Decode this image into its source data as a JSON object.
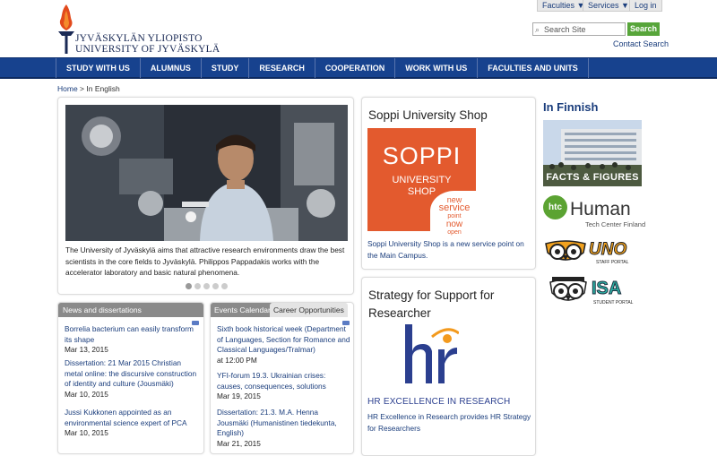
{
  "header": {
    "logo_line1": "JYVÄSKYLÄN YLIOPISTO",
    "logo_line2": "UNIVERSITY OF JYVÄSKYLÄ",
    "top_links": [
      "Faculties ▼",
      "Services ▼",
      "Log in"
    ],
    "search_placeholder": "Search Site",
    "search_button": "Search",
    "contact_search": "Contact Search"
  },
  "nav": {
    "items": [
      "STUDY WITH US",
      "ALUMNUS",
      "STUDY",
      "RESEARCH",
      "COOPERATION",
      "WORK WITH US",
      "FACULTIES AND UNITS"
    ]
  },
  "breadcrumb": {
    "home": "Home",
    "sep": " > ",
    "current": "In English"
  },
  "hero": {
    "caption": "The University of Jyväskylä aims that attractive research environments draw the best scientists in the core fields to Jyväskylä. Philippos Pappadakis works with the accelerator laboratory and basic natural phenomena."
  },
  "news": {
    "header": "News and dissertations",
    "items": [
      {
        "title": "Borrelia bacterium can easily transform its shape",
        "date": "Mar 13, 2015"
      },
      {
        "title": "Dissertation: 21 Mar 2015 Christian metal online: the discursive construction of identity and culture (Jousmäki)",
        "date": "Mar 10, 2015"
      },
      {
        "title": "Jussi Kukkonen appointed as an environmental science expert of PCA",
        "date": "Mar 10, 2015"
      }
    ]
  },
  "events": {
    "tabs": [
      "Events Calendar",
      "Career Opportunities"
    ],
    "items": [
      {
        "title": "Sixth book historical week (Department of Languages, Section for Romance and Classical Languages/Tralmar)",
        "date": "at 12:00 PM"
      },
      {
        "title": "YFI-forum 19.3. Ukrainian crises: causes, consequences, solutions",
        "date": "Mar 19, 2015"
      },
      {
        "title": "Dissertation: 21.3. M.A. Henna Jousmäki (Humanistinen tiedekunta, English)",
        "date": "Mar 21, 2015"
      }
    ]
  },
  "shop": {
    "title": "Soppi University Shop",
    "logo_big": "SOPPI",
    "logo_line1": "UNIVERSITY",
    "logo_line2": "SHOP",
    "badge": [
      "new",
      "service",
      "point",
      "now",
      "open"
    ],
    "desc": "Soppi University Shop is a new service point on the Main Campus."
  },
  "strategy": {
    "title_line1": "Strategy for Support for",
    "title_line2": "Researcher",
    "hr_letters": "hr",
    "hr_caption": "HR EXCELLENCE IN RESEARCH",
    "desc": "HR Excellence in Research provides HR Strategy for Researchers"
  },
  "sidebar": {
    "in_finnish": "In Finnish",
    "facts": "FACTS & FIGURES",
    "htc_badge": "htc",
    "htc_title": "Human",
    "htc_sub": "Tech Center Finland",
    "uno": "UNO",
    "uno_sub": "STAFF PORTAL",
    "isa": "ISA",
    "isa_sub": "STUDENT PORTAL"
  },
  "colors": {
    "nav": "#17428e",
    "search_btn": "#57a53a",
    "soppi": "#e35a2e",
    "link": "#1a3d7c",
    "htc_green": "#5ba332",
    "hr_orange": "#f39a1e",
    "hr_blue": "#2b3f8f"
  }
}
